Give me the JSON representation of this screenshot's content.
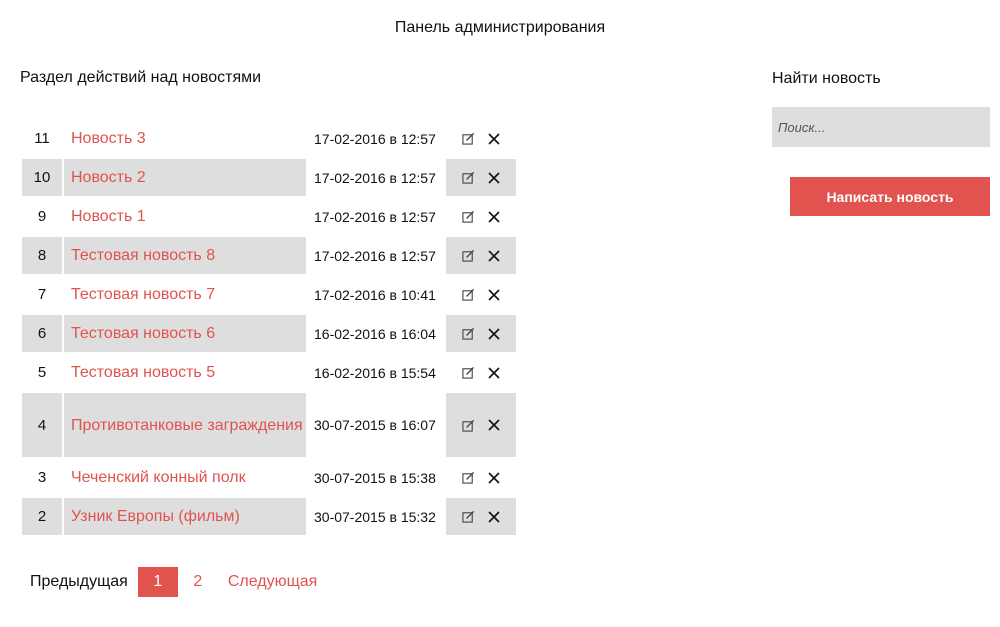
{
  "header": {
    "title": "Панель администрирования"
  },
  "main": {
    "section_title": "Раздел действий над новостями",
    "news": [
      {
        "id": "11",
        "title": "Новость 3",
        "date": "17-02-2016 в 12:57"
      },
      {
        "id": "10",
        "title": "Новость 2",
        "date": "17-02-2016 в 12:57"
      },
      {
        "id": "9",
        "title": "Новость 1",
        "date": "17-02-2016 в 12:57"
      },
      {
        "id": "8",
        "title": "Тестовая новость 8",
        "date": "17-02-2016 в 12:57"
      },
      {
        "id": "7",
        "title": "Тестовая новость 7",
        "date": "17-02-2016 в 10:41"
      },
      {
        "id": "6",
        "title": "Тестовая новость 6",
        "date": "16-02-2016 в 16:04"
      },
      {
        "id": "5",
        "title": "Тестовая новость 5",
        "date": "16-02-2016 в 15:54"
      },
      {
        "id": "4",
        "title": "Противотанковые заграждения",
        "date": "30-07-2015 в 16:07"
      },
      {
        "id": "3",
        "title": "Чеченский конный полк",
        "date": "30-07-2015 в 15:38"
      },
      {
        "id": "2",
        "title": "Узник Европы (фильм)",
        "date": "30-07-2015 в 15:32"
      }
    ],
    "row_icons": {
      "edit": "edit-icon",
      "delete": "close-icon"
    }
  },
  "pagination": {
    "prev_label": "Предыдущая",
    "pages": [
      "1",
      "2"
    ],
    "active_page": "1",
    "next_label": "Следующая"
  },
  "sidebar": {
    "title": "Найти новость",
    "search_placeholder": "Поиск...",
    "write_button_label": "Написать новость"
  },
  "colors": {
    "accent": "#e0534f",
    "shade": "#dedede"
  }
}
